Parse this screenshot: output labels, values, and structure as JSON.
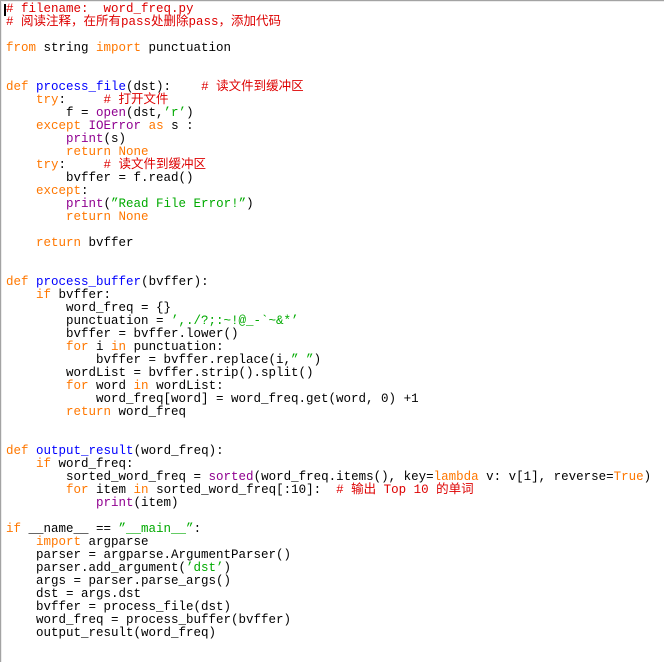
{
  "app": {
    "title": "word_freq.py",
    "kind": "python-code-editor"
  },
  "editor": {
    "background": "#ffffff",
    "caret_color": "#000000",
    "border_color": "#a3a3a3",
    "colors": {
      "plain": "#000000",
      "keyword": "#FF7700",
      "builtin": "#900090",
      "string": "#00AA00",
      "comment": "#DD0000",
      "definition": "#0000FF"
    },
    "lines": [
      [
        {
          "t": "# filename:  word_freq.py",
          "c": "comment"
        }
      ],
      [
        {
          "t": "# 阅读注释，在所有pass处删除pass，添加代码",
          "c": "comment"
        }
      ],
      [],
      [
        {
          "t": "from",
          "c": "keyword"
        },
        {
          "t": " string ",
          "c": "plain"
        },
        {
          "t": "import",
          "c": "keyword"
        },
        {
          "t": " punctuation",
          "c": "plain"
        }
      ],
      [],
      [],
      [
        {
          "t": "def",
          "c": "keyword"
        },
        {
          "t": " ",
          "c": "plain"
        },
        {
          "t": "process_file",
          "c": "definition"
        },
        {
          "t": "(dst):    ",
          "c": "plain"
        },
        {
          "t": "# 读文件到缓冲区",
          "c": "comment"
        }
      ],
      [
        {
          "t": "    ",
          "c": "plain"
        },
        {
          "t": "try",
          "c": "keyword"
        },
        {
          "t": ":     ",
          "c": "plain"
        },
        {
          "t": "# 打开文件",
          "c": "comment"
        }
      ],
      [
        {
          "t": "        f = ",
          "c": "plain"
        },
        {
          "t": "open",
          "c": "builtin"
        },
        {
          "t": "(dst,",
          "c": "plain"
        },
        {
          "t": "’r’",
          "c": "string"
        },
        {
          "t": ")",
          "c": "plain"
        }
      ],
      [
        {
          "t": "    ",
          "c": "plain"
        },
        {
          "t": "except",
          "c": "keyword"
        },
        {
          "t": " ",
          "c": "plain"
        },
        {
          "t": "IOError",
          "c": "builtin"
        },
        {
          "t": " ",
          "c": "plain"
        },
        {
          "t": "as",
          "c": "keyword"
        },
        {
          "t": " s :",
          "c": "plain"
        }
      ],
      [
        {
          "t": "        ",
          "c": "plain"
        },
        {
          "t": "print",
          "c": "builtin"
        },
        {
          "t": "(s)",
          "c": "plain"
        }
      ],
      [
        {
          "t": "        ",
          "c": "plain"
        },
        {
          "t": "return",
          "c": "keyword"
        },
        {
          "t": " ",
          "c": "plain"
        },
        {
          "t": "None",
          "c": "keyword"
        }
      ],
      [
        {
          "t": "    ",
          "c": "plain"
        },
        {
          "t": "try",
          "c": "keyword"
        },
        {
          "t": ":     ",
          "c": "plain"
        },
        {
          "t": "# 读文件到缓冲区",
          "c": "comment"
        }
      ],
      [
        {
          "t": "        bvffer = f.read()",
          "c": "plain"
        }
      ],
      [
        {
          "t": "    ",
          "c": "plain"
        },
        {
          "t": "except",
          "c": "keyword"
        },
        {
          "t": ":",
          "c": "plain"
        }
      ],
      [
        {
          "t": "        ",
          "c": "plain"
        },
        {
          "t": "print",
          "c": "builtin"
        },
        {
          "t": "(",
          "c": "plain"
        },
        {
          "t": "”Read File Error!”",
          "c": "string"
        },
        {
          "t": ")",
          "c": "plain"
        }
      ],
      [
        {
          "t": "        ",
          "c": "plain"
        },
        {
          "t": "return",
          "c": "keyword"
        },
        {
          "t": " ",
          "c": "plain"
        },
        {
          "t": "None",
          "c": "keyword"
        }
      ],
      [],
      [
        {
          "t": "    ",
          "c": "plain"
        },
        {
          "t": "return",
          "c": "keyword"
        },
        {
          "t": " bvffer",
          "c": "plain"
        }
      ],
      [],
      [],
      [
        {
          "t": "def",
          "c": "keyword"
        },
        {
          "t": " ",
          "c": "plain"
        },
        {
          "t": "process_buffer",
          "c": "definition"
        },
        {
          "t": "(bvffer):",
          "c": "plain"
        }
      ],
      [
        {
          "t": "    ",
          "c": "plain"
        },
        {
          "t": "if",
          "c": "keyword"
        },
        {
          "t": " bvffer:",
          "c": "plain"
        }
      ],
      [
        {
          "t": "        word_freq = {}",
          "c": "plain"
        }
      ],
      [
        {
          "t": "        punctuation = ",
          "c": "plain"
        },
        {
          "t": "’,./?;:~!@_-`~&*’",
          "c": "string"
        }
      ],
      [
        {
          "t": "        bvffer = bvffer.lower()",
          "c": "plain"
        }
      ],
      [
        {
          "t": "        ",
          "c": "plain"
        },
        {
          "t": "for",
          "c": "keyword"
        },
        {
          "t": " i ",
          "c": "plain"
        },
        {
          "t": "in",
          "c": "keyword"
        },
        {
          "t": " punctuation:",
          "c": "plain"
        }
      ],
      [
        {
          "t": "            bvffer = bvffer.replace(i,",
          "c": "plain"
        },
        {
          "t": "” ”",
          "c": "string"
        },
        {
          "t": ")",
          "c": "plain"
        }
      ],
      [
        {
          "t": "        wordList = bvffer.strip().split()",
          "c": "plain"
        }
      ],
      [
        {
          "t": "        ",
          "c": "plain"
        },
        {
          "t": "for",
          "c": "keyword"
        },
        {
          "t": " word ",
          "c": "plain"
        },
        {
          "t": "in",
          "c": "keyword"
        },
        {
          "t": " wordList:",
          "c": "plain"
        }
      ],
      [
        {
          "t": "            word_freq[word] = word_freq.get(word, 0) +1",
          "c": "plain"
        }
      ],
      [
        {
          "t": "        ",
          "c": "plain"
        },
        {
          "t": "return",
          "c": "keyword"
        },
        {
          "t": " word_freq",
          "c": "plain"
        }
      ],
      [],
      [],
      [
        {
          "t": "def",
          "c": "keyword"
        },
        {
          "t": " ",
          "c": "plain"
        },
        {
          "t": "output_result",
          "c": "definition"
        },
        {
          "t": "(word_freq):",
          "c": "plain"
        }
      ],
      [
        {
          "t": "    ",
          "c": "plain"
        },
        {
          "t": "if",
          "c": "keyword"
        },
        {
          "t": " word_freq:",
          "c": "plain"
        }
      ],
      [
        {
          "t": "        sorted_word_freq = ",
          "c": "plain"
        },
        {
          "t": "sorted",
          "c": "builtin"
        },
        {
          "t": "(word_freq.items(), key=",
          "c": "plain"
        },
        {
          "t": "lambda",
          "c": "keyword"
        },
        {
          "t": " v: v[1], reverse=",
          "c": "plain"
        },
        {
          "t": "True",
          "c": "keyword"
        },
        {
          "t": ")",
          "c": "plain"
        }
      ],
      [
        {
          "t": "        ",
          "c": "plain"
        },
        {
          "t": "for",
          "c": "keyword"
        },
        {
          "t": " item ",
          "c": "plain"
        },
        {
          "t": "in",
          "c": "keyword"
        },
        {
          "t": " sorted_word_freq[:10]:  ",
          "c": "plain"
        },
        {
          "t": "# 输出 Top 10 的单词",
          "c": "comment"
        }
      ],
      [
        {
          "t": "            ",
          "c": "plain"
        },
        {
          "t": "print",
          "c": "builtin"
        },
        {
          "t": "(item)",
          "c": "plain"
        }
      ],
      [],
      [
        {
          "t": "if",
          "c": "keyword"
        },
        {
          "t": " __name__ == ",
          "c": "plain"
        },
        {
          "t": "”__main__”",
          "c": "string"
        },
        {
          "t": ":",
          "c": "plain"
        }
      ],
      [
        {
          "t": "    ",
          "c": "plain"
        },
        {
          "t": "import",
          "c": "keyword"
        },
        {
          "t": " argparse",
          "c": "plain"
        }
      ],
      [
        {
          "t": "    parser = argparse.ArgumentParser()",
          "c": "plain"
        }
      ],
      [
        {
          "t": "    parser.add_argument(",
          "c": "plain"
        },
        {
          "t": "’dst’",
          "c": "string"
        },
        {
          "t": ")",
          "c": "plain"
        }
      ],
      [
        {
          "t": "    args = parser.parse_args()",
          "c": "plain"
        }
      ],
      [
        {
          "t": "    dst = args.dst",
          "c": "plain"
        }
      ],
      [
        {
          "t": "    bvffer = process_file(dst)",
          "c": "plain"
        }
      ],
      [
        {
          "t": "    word_freq = process_buffer(bvffer)",
          "c": "plain"
        }
      ],
      [
        {
          "t": "    output_result(word_freq)",
          "c": "plain"
        }
      ]
    ]
  }
}
